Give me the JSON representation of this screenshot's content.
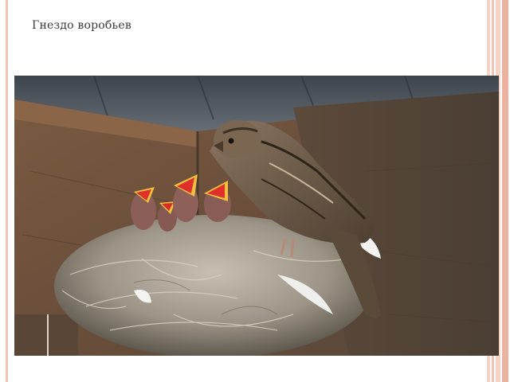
{
  "slide": {
    "title": "Гнездо воробьев"
  },
  "photo": {
    "subject": "sparrow-feeding-chicks-in-nest",
    "colors": {
      "roof": "#5a6068",
      "wall": "#6e5440",
      "nest": "#a39a8c",
      "sparrow": "#6b5a48",
      "beak_inside": "#e0302c",
      "beak_rim": "#f2c040"
    }
  },
  "decor": {
    "stripe_colors": [
      "#f2c4b4",
      "#f6d3c6",
      "#eab29f"
    ]
  }
}
